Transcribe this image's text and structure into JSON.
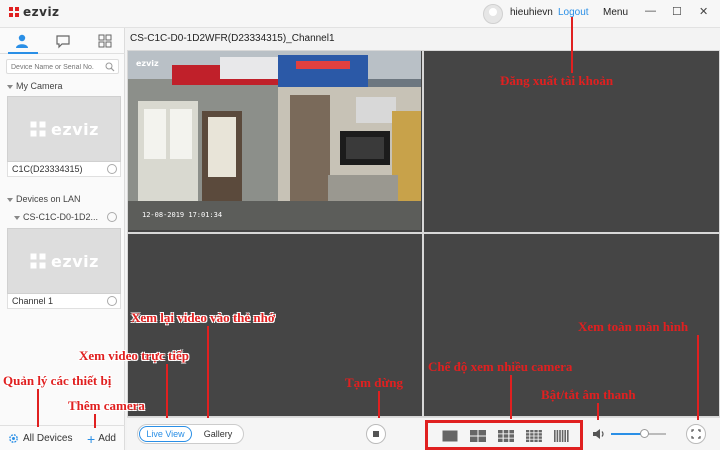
{
  "app": {
    "logo_text": "ezviz",
    "username": "hieuhievn",
    "logout_label": "Logout",
    "menu_label": "Menu",
    "win_min": "—",
    "win_max": "☐",
    "win_close": "✕"
  },
  "sidebar": {
    "search_placeholder": "Device Name or Serial No.",
    "my_camera_header": "My Camera",
    "my_camera_device": "C1C(D23334315)",
    "lan_header": "Devices on LAN",
    "lan_device": "CS-C1C-D0-1D2...",
    "lan_channel": "Channel 1",
    "thumb_logo_text": "ezviz",
    "all_devices_label": "All Devices",
    "add_label": "Add"
  },
  "main": {
    "channel_title": "CS-C1C-D0-1D2WFR(D23334315)_Channel1",
    "video_timestamp": "12-08-2019 17:01:34",
    "video_logo": "ezviz"
  },
  "controls": {
    "live_view_label": "Live View",
    "gallery_label": "Gallery",
    "volume_level": 0.6
  },
  "annotations": {
    "logout": "Đăng xuất tài khoản",
    "playback": "Xem lại video vào thẻ nhớ",
    "live": "Xem video trực tiếp",
    "manage": "Quản lý các thiết bị",
    "add": "Thêm camera",
    "pause": "Tạm dừng",
    "multiview": "Chế độ xem nhiều camera",
    "sound": "Bật/tắt âm thanh",
    "fullscreen": "Xem toàn màn hình"
  },
  "colors": {
    "accent": "#2a8fe6",
    "annotation": "#e02020",
    "empty_cell": "#454545"
  }
}
